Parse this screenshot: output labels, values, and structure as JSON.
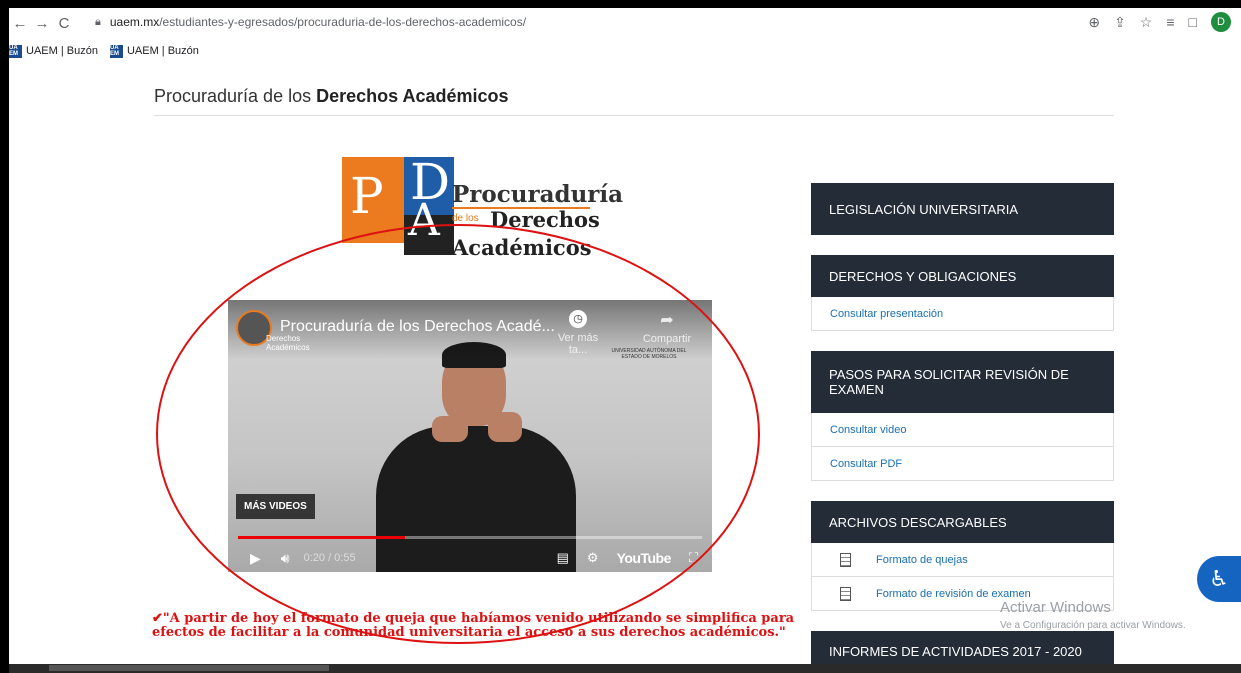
{
  "browser": {
    "url_host": "uaem.mx",
    "url_path": "/estudiantes-y-egresados/procuraduria-de-los-derechos-academicos/",
    "avatar_letter": "D",
    "bookmarks": [
      {
        "label": "UAEM | Buzón",
        "icon_text": "UA EM"
      },
      {
        "label": "UAEM | Buzón",
        "icon_text": "UA EM"
      }
    ]
  },
  "page": {
    "title_prefix": "Procuraduría de los ",
    "title_bold": "Derechos Académicos"
  },
  "logo": {
    "letter_p": "P",
    "letter_d": "D",
    "letter_a": "A",
    "line1": "Procuraduría",
    "line2_small": "de los",
    "line2": "Derechos",
    "line3": "Académicos"
  },
  "video": {
    "title": "Procuraduría de los Derechos Acadé...",
    "channel_mini": "Derechos\nAcadémicos",
    "watch_later": "Ver más ta...",
    "share": "Compartir",
    "university_mark": "UNIVERSIDAD AUTÓNOMA DEL ESTADO DE MORELOS",
    "more_videos": "MÁS VIDEOS",
    "time": "0:20 / 0:55",
    "progress": 0.36,
    "youtube": "YouTube"
  },
  "quote": {
    "check": "✔",
    "text": "\"A partir de hoy el formato de queja que habíamos venido utilizando se simplifica para efectos de facilitar a la comunidad universitaria el acceso a sus derechos académicos.\""
  },
  "sidebar": {
    "legislacion": "LEGISLACIÓN UNIVERSITARIA",
    "derechos": "DERECHOS Y OBLIGACIONES",
    "derechos_link": "Consultar presentación",
    "pasos": "PASOS PARA SOLICITAR REVISIÓN DE EXAMEN",
    "pasos_link1": "Consultar video",
    "pasos_link2": "Consultar PDF",
    "archivos": "ARCHIVOS DESCARGABLES",
    "archivos_link1": "Formato de quejas",
    "archivos_link2": "Formato de revisión de examen",
    "informes": "INFORMES DE ACTIVIDADES 2017 - 2020"
  },
  "windows": {
    "activate": "Activar Windows",
    "activate_sub": "Ve a Configuración para activar Windows."
  },
  "colors": {
    "sidebar_header": "#242c38",
    "link": "#1a6fb1",
    "quote_red": "#dd1111",
    "logo_orange": "#ec7a1e",
    "logo_blue": "#1f5da8"
  }
}
